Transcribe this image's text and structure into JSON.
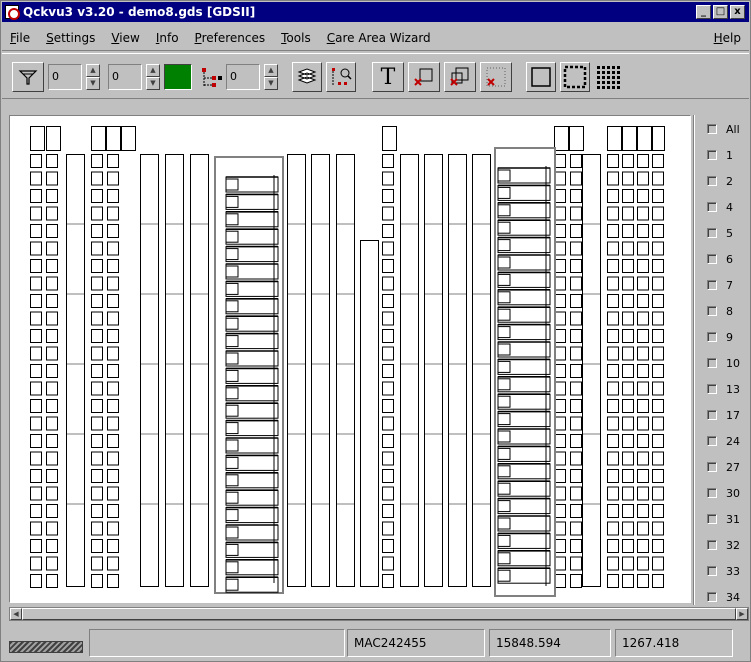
{
  "window": {
    "title": "Qckvu3 v3.20 - demo8.gds [GDSII]",
    "controls": [
      "_",
      "□",
      "x"
    ]
  },
  "menu": {
    "items": [
      "File",
      "Settings",
      "View",
      "Info",
      "Preferences",
      "Tools",
      "Care Area Wizard"
    ],
    "help": "Help"
  },
  "toolbar": {
    "filter_value_1": "0",
    "filter_value_2": "0",
    "hierarchy_value": "0",
    "text_tool_label": "T",
    "fill_color": "#008000"
  },
  "layers": {
    "all_label": "All",
    "items": [
      "1",
      "2",
      "4",
      "5",
      "6",
      "7",
      "8",
      "9",
      "10",
      "13",
      "17",
      "24",
      "27",
      "30",
      "31",
      "32",
      "33",
      "34"
    ]
  },
  "status": {
    "cell": "MAC242455",
    "x": "15848.594",
    "y": "1267.418"
  }
}
